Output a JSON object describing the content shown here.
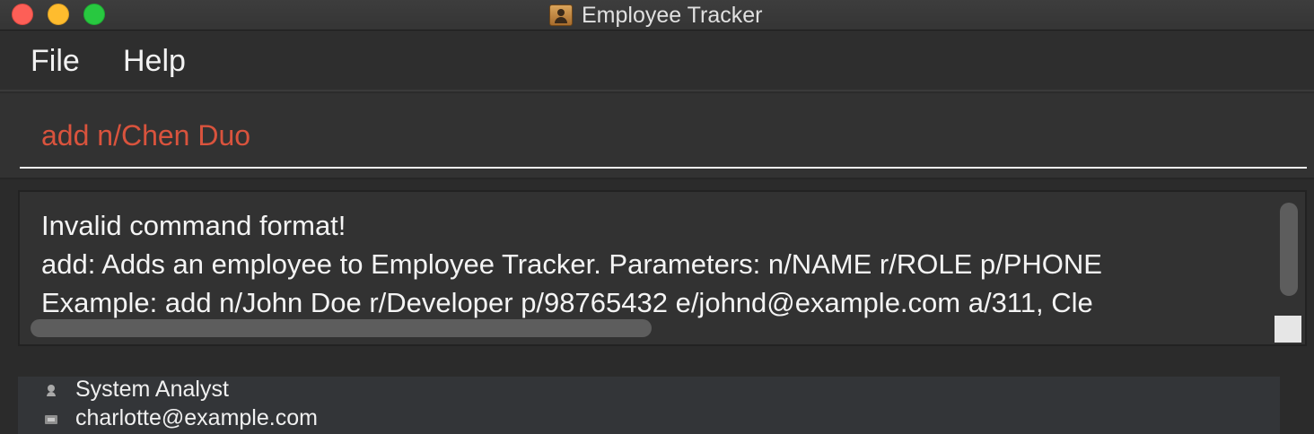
{
  "window": {
    "title": "Employee Tracker",
    "app_icon": "contact-card-icon"
  },
  "menu": {
    "items": [
      {
        "label": "File"
      },
      {
        "label": "Help"
      }
    ]
  },
  "command_box": {
    "value": "add n/Chen Duo",
    "text_color": "#d9533d"
  },
  "result_display": {
    "lines": [
      "Invalid command format!",
      "add: Adds an employee to Employee Tracker. Parameters: n/NAME r/ROLE p/PHONE",
      "Example: add n/John Doe r/Developer p/98765432 e/johnd@example.com a/311, Cle"
    ]
  },
  "employee_card": {
    "role": "System Analyst",
    "role_icon": "person-icon",
    "email": "charlotte@example.com",
    "email_icon": "email-icon"
  }
}
